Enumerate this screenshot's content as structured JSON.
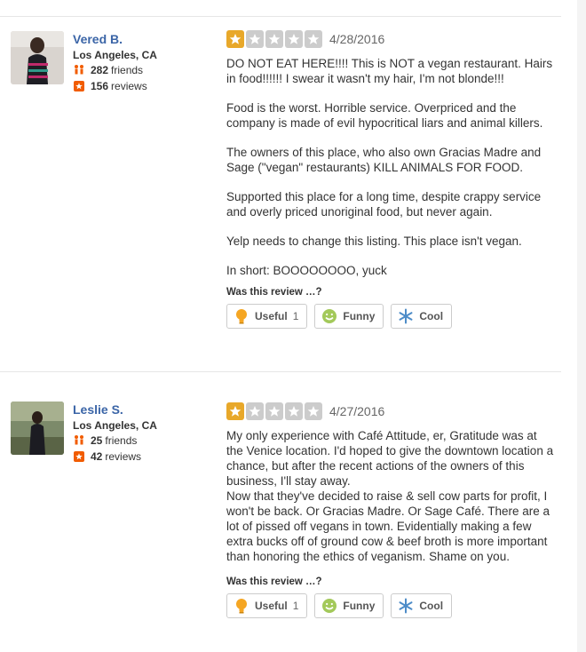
{
  "colors": {
    "star_on": "#e8a82a",
    "star_off": "#cccccc",
    "name": "#3b65a7",
    "friends_icon": "#f15c00",
    "reviews_icon": "#f15c00"
  },
  "vote_label": "Was this review …?",
  "buttons": {
    "useful": "Useful",
    "funny": "Funny",
    "cool": "Cool"
  },
  "reviews": [
    {
      "user": {
        "name": "Vered B.",
        "location": "Los Angeles, CA",
        "friends_count": "282",
        "friends_label": "friends",
        "reviews_count": "156",
        "reviews_label": "reviews"
      },
      "rating": 1,
      "date": "4/28/2016",
      "paragraphs": [
        "DO NOT EAT HERE!!!! This is NOT a vegan restaurant. Hairs in food!!!!!! I swear it wasn't my hair, I'm not blonde!!!",
        "Food is the worst. Horrible service. Overpriced and the company is made of evil hypocritical liars and animal killers.",
        "The owners of this place, who also own Gracias Madre and Sage (\"vegan\" restaurants) KILL ANIMALS FOR FOOD.",
        "Supported this place for a long time, despite crappy service and overly priced unoriginal food, but never again.",
        "Yelp needs to change this listing. This place isn't vegan.",
        "In short: BOOOOOOOO, yuck"
      ],
      "useful_count": "1"
    },
    {
      "user": {
        "name": "Leslie S.",
        "location": "Los Angeles, CA",
        "friends_count": "25",
        "friends_label": "friends",
        "reviews_count": "42",
        "reviews_label": "reviews"
      },
      "rating": 1,
      "date": "4/27/2016",
      "paragraphs": [
        "My only experience with Café Attitude, er, Gratitude was at the Venice location. I'd hoped to give the downtown location a chance, but after the recent actions of the owners of this business, I'll stay away.",
        "Now that they've decided to raise & sell cow parts for profit, I won't be back. Or Gracias Madre. Or Sage Café. There are a lot of pissed off vegans in town. Evidentially making a few extra bucks off of ground cow & beef broth is more important than honoring the ethics of veganism. Shame on you."
      ],
      "useful_count": "1"
    }
  ]
}
